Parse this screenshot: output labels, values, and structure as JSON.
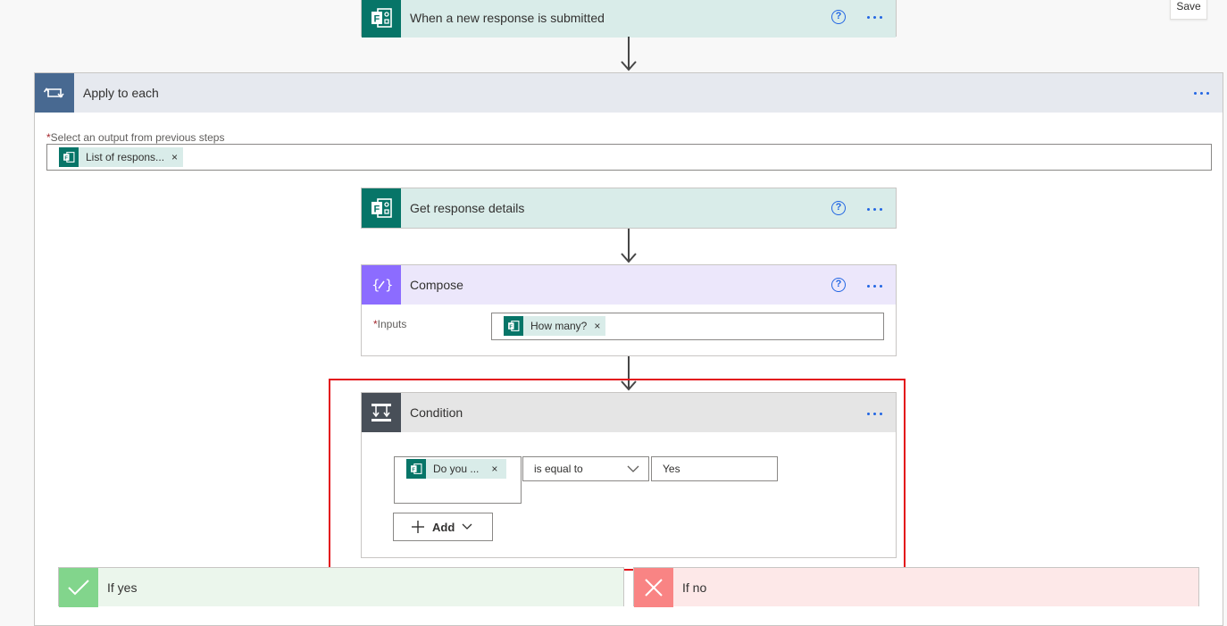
{
  "save_button": "Save",
  "trigger": {
    "title": "When a new response is submitted",
    "help": "?"
  },
  "apply_each": {
    "title": "Apply to each",
    "field_label": "Select an output from previous steps",
    "required_mark": "*",
    "token_label": "List of respons...",
    "token_close": "×"
  },
  "get_response": {
    "title": "Get response details",
    "help": "?"
  },
  "compose": {
    "title": "Compose",
    "help": "?",
    "inputs_label": "Inputs",
    "required_mark": "*",
    "token_label": "How many?",
    "token_close": "×"
  },
  "condition": {
    "title": "Condition",
    "token_label": "Do you ...",
    "token_close": "×",
    "operator": "is equal to",
    "value": "Yes",
    "add_label": "Add"
  },
  "branches": {
    "yes_label": "If yes",
    "no_label": "If no"
  },
  "colors": {
    "forms_green": "#077568",
    "forms_header": "#d9ece9",
    "apply_header": "#e6e9ef",
    "apply_icon": "#486991",
    "compose_header": "#ece7fb",
    "compose_icon": "#8c6cff",
    "condition_header": "#e5e5e5",
    "condition_icon": "#484f58",
    "highlight": "#e3121a",
    "yes_header": "#ebf6ec",
    "yes_icon": "#82d58c",
    "no_header": "#fde8e8",
    "no_icon": "#f98484",
    "accent": "#2266e3"
  }
}
